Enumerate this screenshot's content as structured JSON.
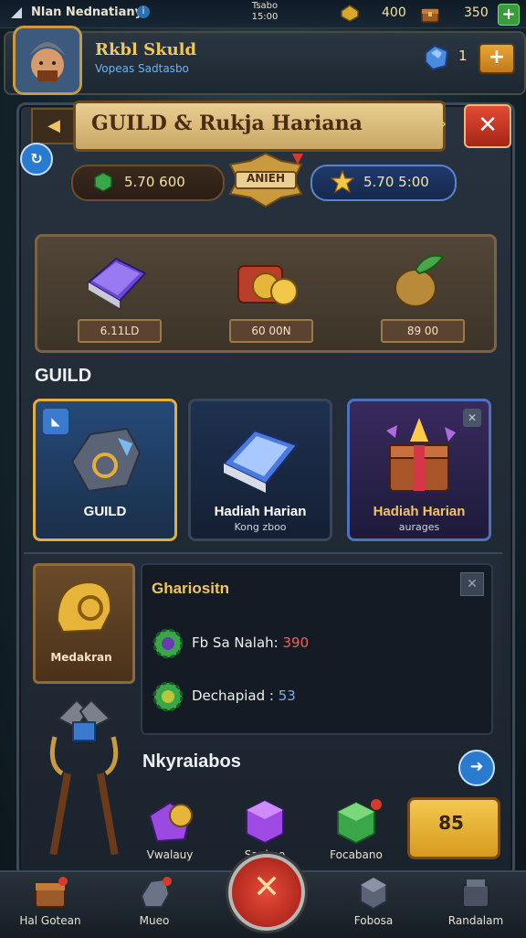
{
  "status_bar": {
    "player_name": "Nlan Nednatiany",
    "clock": "Tsabo\n15:00",
    "gold": "400",
    "gems": "350"
  },
  "profile": {
    "name": "Rkbl Skuld",
    "subtitle": "Vopeas Sadtasbo",
    "gem_count": "1"
  },
  "panel": {
    "title": "GUILD & Rukja Harianа"
  },
  "currencies": {
    "left_value": "5.70 600",
    "badge_label": "ANIEH",
    "right_value": "5.70 5:00"
  },
  "rewards": [
    {
      "label": "6.11LD"
    },
    {
      "label": "60 00N"
    },
    {
      "label": "89 00"
    }
  ],
  "section_title": "GUILD",
  "cards": [
    {
      "title": "GUILD",
      "subtitle": ""
    },
    {
      "title": "Hadiah Harian",
      "subtitle": "Kong zboo"
    },
    {
      "title": "Hadiah Harian",
      "subtitle": "aurages"
    }
  ],
  "helmet_label": "Medakran",
  "stats": {
    "heading": "Ghariositn",
    "row1_label": "Fb Sa Nalah: ",
    "row1_value": "390",
    "row2_label": "Dechapiad : ",
    "row2_value": "53"
  },
  "new_section": {
    "title": "Nkyraiabos",
    "items": [
      {
        "label": "Vwalauy"
      },
      {
        "label": "Sankno"
      },
      {
        "label": "Focabano"
      }
    ],
    "buy_value": "85"
  },
  "bottom_nav": [
    {
      "label": "Hal Gotean"
    },
    {
      "label": "Mueo"
    },
    {
      "label": "Fobosa"
    },
    {
      "label": "Randalam"
    }
  ],
  "colors": {
    "accent_gold": "#f0c75a",
    "close_red": "#e24b36",
    "panel_bg": "#27323e"
  }
}
